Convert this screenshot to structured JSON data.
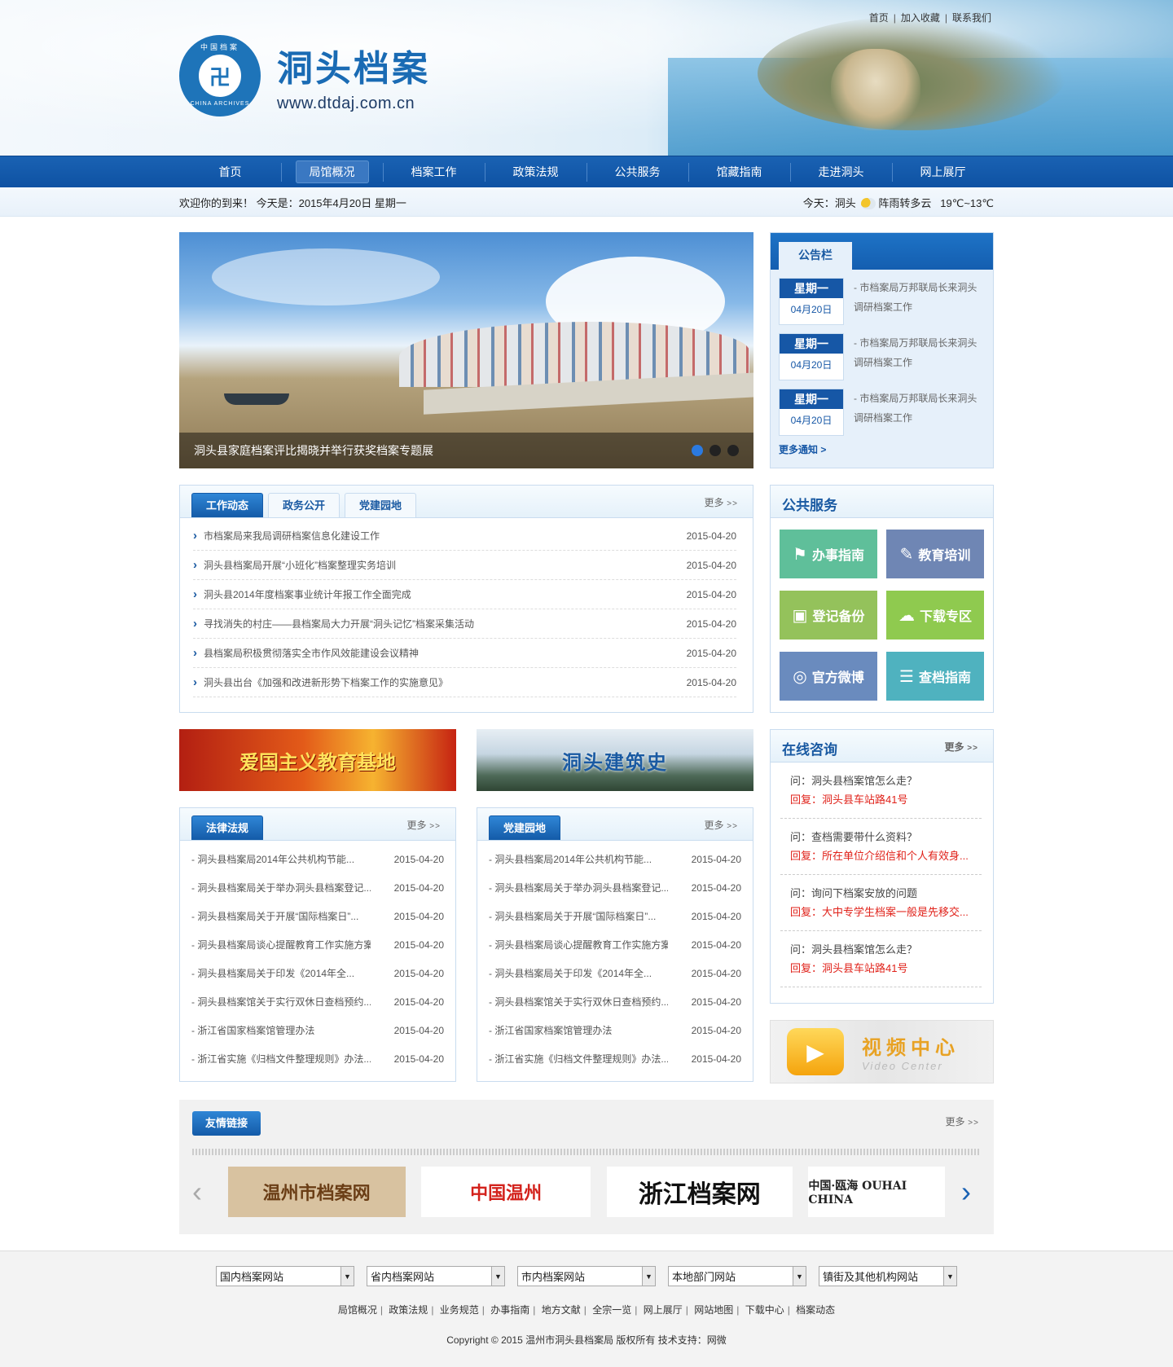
{
  "header": {
    "logo_title": "洞头档案",
    "logo_url": "www.dtdaj.com.cn",
    "emblem_top": "中国档案",
    "emblem_bottom": "CHINA ARCHIVES",
    "top_links": [
      "首页",
      "加入收藏",
      "联系我们"
    ]
  },
  "nav": {
    "items": [
      "首页",
      "局馆概况",
      "档案工作",
      "政策法规",
      "公共服务",
      "馆藏指南",
      "走进洞头",
      "网上展厅"
    ],
    "active_index": 1
  },
  "welcome": {
    "greeting": "欢迎你的到来！ 今天是：2015年4月20日  星期一",
    "weather_prefix": "今天：洞头",
    "weather_desc": "阵雨转多云",
    "temperature": "19℃~13℃"
  },
  "slideshow": {
    "caption": "洞头县家庭档案评比揭晓并举行获奖档案专题展",
    "slide_count": 3,
    "active_slide": 1
  },
  "notice": {
    "title": "公告栏",
    "items": [
      {
        "weekday": "星期一",
        "date": "04月20日",
        "text": "- 市档案局万邦联局长来洞头调研档案工作"
      },
      {
        "weekday": "星期一",
        "date": "04月20日",
        "text": "- 市档案局万邦联局长来洞头调研档案工作"
      },
      {
        "weekday": "星期一",
        "date": "04月20日",
        "text": "- 市档案局万邦联局长来洞头调研档案工作"
      }
    ],
    "more": "更多通知 >"
  },
  "news": {
    "tabs": [
      "工作动态",
      "政务公开",
      "党建园地"
    ],
    "more": "更多",
    "items": [
      {
        "title": "市档案局来我局调研档案信息化建设工作",
        "date": "2015-04-20"
      },
      {
        "title": "洞头县档案局开展“小班化”档案整理实务培训",
        "date": "2015-04-20"
      },
      {
        "title": "洞头县2014年度档案事业统计年报工作全面完成",
        "date": "2015-04-20"
      },
      {
        "title": "寻找消失的村庄——县档案局大力开展“洞头记忆”档案采集活动",
        "date": "2015-04-20"
      },
      {
        "title": "县档案局积极贯彻落实全市作风效能建设会议精神",
        "date": "2015-04-20"
      },
      {
        "title": "洞头县出台《加强和改进新形势下档案工作的实施意见》",
        "date": "2015-04-20"
      }
    ]
  },
  "services": {
    "title": "公共服务",
    "items": [
      {
        "label": "办事指南",
        "icon": "signpost-icon",
        "glyph": "⚑",
        "color": "#5fbf9a"
      },
      {
        "label": "教育培训",
        "icon": "book-icon",
        "glyph": "✎",
        "color": "#6f86b4"
      },
      {
        "label": "登记备份",
        "icon": "save-icon",
        "glyph": "▣",
        "color": "#94c25b"
      },
      {
        "label": "下载专区",
        "icon": "cloud-download-icon",
        "glyph": "☁",
        "color": "#8fca4f"
      },
      {
        "label": "官方微博",
        "icon": "weibo-icon",
        "glyph": "◎",
        "color": "#6a8bbe"
      },
      {
        "label": "查档指南",
        "icon": "archive-icon",
        "glyph": "☰",
        "color": "#4fb2bf"
      }
    ]
  },
  "banners": {
    "left": "爱国主义教育基地",
    "right": "洞头建筑史"
  },
  "law": {
    "title": "法律法规",
    "more": "更多",
    "items": [
      {
        "title": "洞头县档案局2014年公共机构节能...",
        "date": "2015-04-20"
      },
      {
        "title": "洞头县档案局关于举办洞头县档案登记...",
        "date": "2015-04-20"
      },
      {
        "title": "洞头县档案局关于开展“国际档案日”...",
        "date": "2015-04-20"
      },
      {
        "title": "洞头县档案局谈心提醒教育工作实施方案",
        "date": "2015-04-20"
      },
      {
        "title": "洞头县档案局关于印发《2014年全...",
        "date": "2015-04-20"
      },
      {
        "title": "洞头县档案馆关于实行双休日查档预约...",
        "date": "2015-04-20"
      },
      {
        "title": "浙江省国家档案馆管理办法",
        "date": "2015-04-20"
      },
      {
        "title": "浙江省实施《归档文件整理规则》办法...",
        "date": "2015-04-20"
      }
    ]
  },
  "party": {
    "title": "党建园地",
    "more": "更多",
    "items": [
      {
        "title": "洞头县档案局2014年公共机构节能...",
        "date": "2015-04-20"
      },
      {
        "title": "洞头县档案局关于举办洞头县档案登记...",
        "date": "2015-04-20"
      },
      {
        "title": "洞头县档案局关于开展“国际档案日”...",
        "date": "2015-04-20"
      },
      {
        "title": "洞头县档案局谈心提醒教育工作实施方案",
        "date": "2015-04-20"
      },
      {
        "title": "洞头县档案局关于印发《2014年全...",
        "date": "2015-04-20"
      },
      {
        "title": "洞头县档案馆关于实行双休日查档预约...",
        "date": "2015-04-20"
      },
      {
        "title": "浙江省国家档案馆管理办法",
        "date": "2015-04-20"
      },
      {
        "title": "浙江省实施《归档文件整理规则》办法...",
        "date": "2015-04-20"
      }
    ]
  },
  "consult": {
    "title": "在线咨询",
    "more": "更多",
    "items": [
      {
        "q": "问：洞头县档案馆怎么走？",
        "a": "回复：洞头县车站路41号"
      },
      {
        "q": "问：查档需要带什么资料？",
        "a": "回复：所在单位介绍信和个人有效身..."
      },
      {
        "q": "问：询问下档案安放的问题",
        "a": "回复：大中专学生档案一般是先移交..."
      },
      {
        "q": "问：洞头县档案馆怎么走？",
        "a": "回复：洞头县车站路41号"
      }
    ]
  },
  "video": {
    "title": "视频中心",
    "subtitle": "Video Center"
  },
  "friends": {
    "title": "友情链接",
    "more": "更多",
    "logos": [
      "温州市档案网",
      "中国温州",
      "浙江档案网",
      "中国·瓯海 OUHAI CHINA"
    ]
  },
  "footer": {
    "selects": [
      "国内档案网站",
      "省内档案网站",
      "市内档案网站",
      "本地部门网站",
      "镇街及其他机构网站"
    ],
    "links": [
      "局馆概况",
      "政策法规",
      "业务规范",
      "办事指南",
      "地方文献",
      "全宗一览",
      "网上展厅",
      "网站地图",
      "下载中心",
      "档案动态"
    ],
    "copyright": "Copyright © 2015 温州市洞头县档案局 版权所有 技术支持：网微"
  }
}
